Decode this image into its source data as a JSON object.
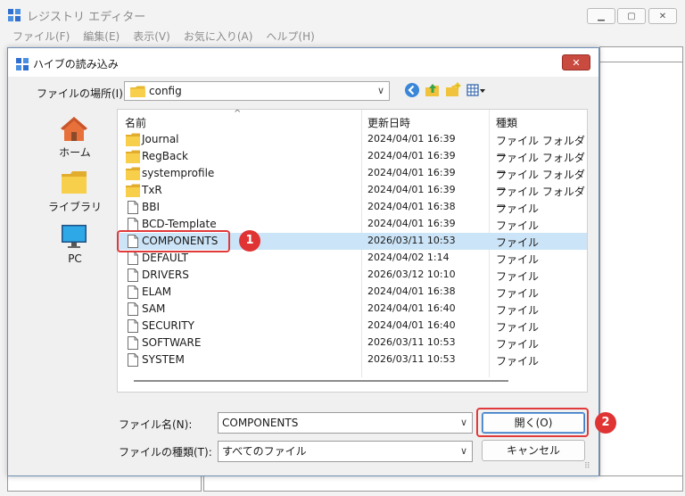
{
  "app": {
    "title": "レジストリ エディター",
    "menu": [
      "ファイル(F)",
      "編集(E)",
      "表示(V)",
      "お気に入り(A)",
      "ヘルプ(H)"
    ]
  },
  "dialog": {
    "title": "ハイブの読み込み",
    "close_glyph": "✕",
    "look_in_label": "ファイルの場所(I):",
    "look_in_value": "config",
    "places": [
      "ホーム",
      "ライブラリ",
      "PC"
    ],
    "columns": {
      "name": "名前",
      "date": "更新日時",
      "type": "種類"
    },
    "files": [
      {
        "name": "Journal",
        "date": "2024/04/01 16:39",
        "type": "ファイル フォルダー",
        "kind": "folder"
      },
      {
        "name": "RegBack",
        "date": "2024/04/01 16:39",
        "type": "ファイル フォルダー",
        "kind": "folder"
      },
      {
        "name": "systemprofile",
        "date": "2024/04/01 16:39",
        "type": "ファイル フォルダー",
        "kind": "folder"
      },
      {
        "name": "TxR",
        "date": "2024/04/01 16:39",
        "type": "ファイル フォルダー",
        "kind": "folder"
      },
      {
        "name": "BBI",
        "date": "2024/04/01 16:38",
        "type": "ファイル",
        "kind": "file"
      },
      {
        "name": "BCD-Template",
        "date": "2024/04/01 16:39",
        "type": "ファイル",
        "kind": "file"
      },
      {
        "name": "COMPONENTS",
        "date": "2026/03/11 10:53",
        "type": "ファイル",
        "kind": "file",
        "selected": true
      },
      {
        "name": "DEFAULT",
        "date": "2024/04/02 1:14",
        "type": "ファイル",
        "kind": "file"
      },
      {
        "name": "DRIVERS",
        "date": "2026/03/12 10:10",
        "type": "ファイル",
        "kind": "file"
      },
      {
        "name": "ELAM",
        "date": "2024/04/01 16:38",
        "type": "ファイル",
        "kind": "file"
      },
      {
        "name": "SAM",
        "date": "2024/04/01 16:40",
        "type": "ファイル",
        "kind": "file"
      },
      {
        "name": "SECURITY",
        "date": "2024/04/01 16:40",
        "type": "ファイル",
        "kind": "file"
      },
      {
        "name": "SOFTWARE",
        "date": "2026/03/11 10:53",
        "type": "ファイル",
        "kind": "file"
      },
      {
        "name": "SYSTEM",
        "date": "2026/03/11 10:53",
        "type": "ファイル",
        "kind": "file"
      }
    ],
    "file_name_label": "ファイル名(N):",
    "file_name_value": "COMPONENTS",
    "file_type_label": "ファイルの種類(T):",
    "file_type_value": "すべてのファイル",
    "open_button": "開く(O)",
    "cancel_button": "キャンセル"
  },
  "annotations": [
    "1",
    "2"
  ],
  "colors": {
    "selection": "#cce4f7",
    "highlight": "#e03a3a",
    "folder": "#f4c842",
    "close_button": "#c94b40"
  }
}
